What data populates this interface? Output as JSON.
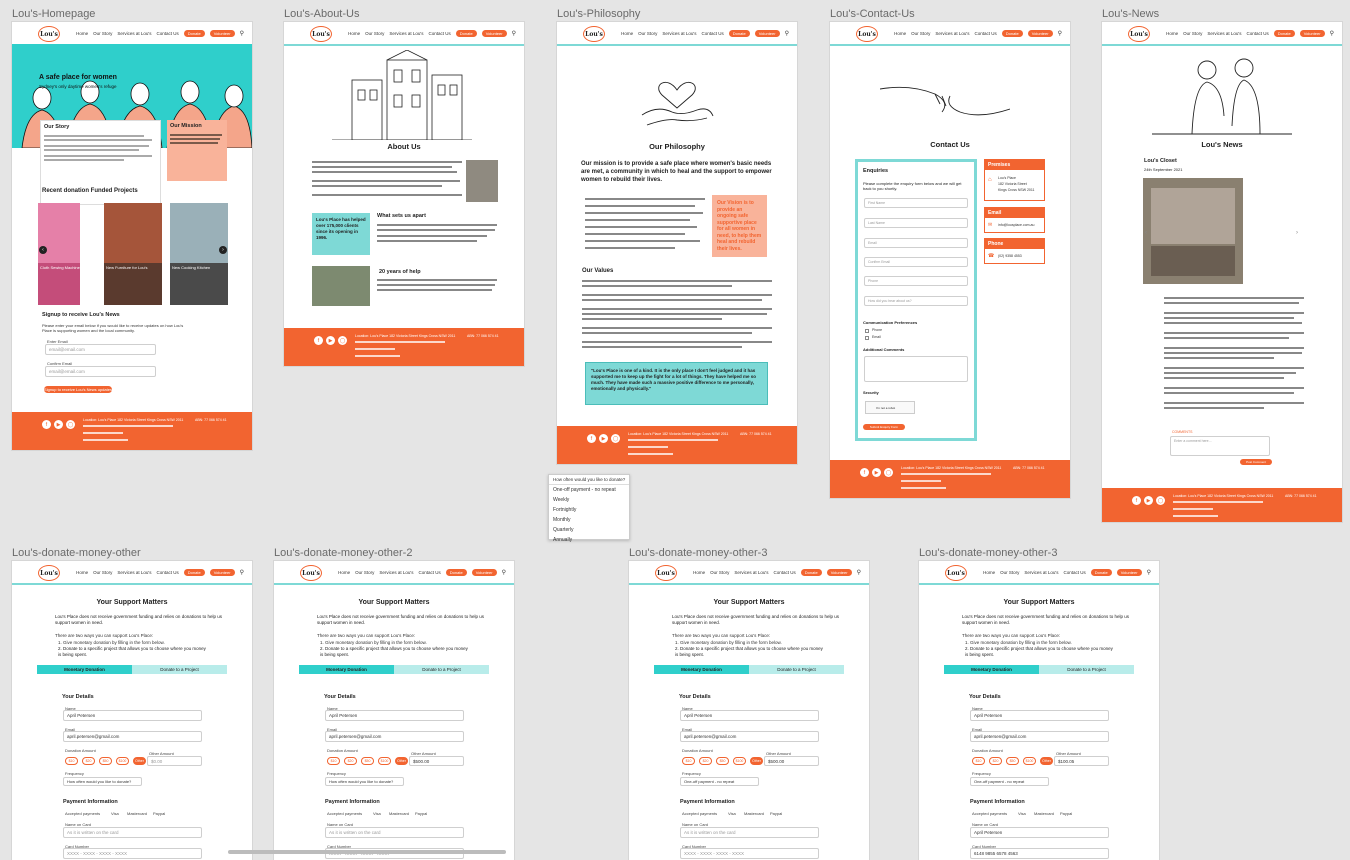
{
  "frames": {
    "homepage": {
      "label": "Lou's-Homepage"
    },
    "about": {
      "label": "Lou's-About-Us"
    },
    "philosophy": {
      "label": "Lou's-Philosophy"
    },
    "contact": {
      "label": "Lou's-Contact-Us"
    },
    "news": {
      "label": "Lou's-News"
    },
    "donate1": {
      "label": "Lou's-donate-money-other"
    },
    "donate2": {
      "label": "Lou's-donate-money-other-2"
    },
    "donate3": {
      "label": "Lou's-donate-money-other-3"
    },
    "donate4": {
      "label": "Lou's-donate-money-other-3"
    }
  },
  "nav": {
    "logo": "Lou's",
    "home": "Home",
    "our_story": "Our Story",
    "services": "Services at Lou's",
    "contact": "Contact Us",
    "donate": "Donate",
    "volunteer": "Volunteer"
  },
  "homepage": {
    "hero_title": "A safe place for women",
    "hero_subtitle": "Sydney's only daytime women's refuge",
    "our_story": "Our Story",
    "our_mission": "Our Mission",
    "recent_projects": "Recent donation Funded Projects",
    "project_1": "Cloth Sewing Machine",
    "project_2": "New Furniture for Lou's",
    "project_3": "New Cooking Kitchen",
    "signup_title": "Signup to receive Lou's News",
    "signup_text": "Please enter your email below if you would like to receive updates on how Lou's Place is supporting women and the local community.",
    "email_label": "Enter Email",
    "email_placeholder": "email@email.com",
    "confirm_label": "Confirm Email",
    "signup_button": "Signup to receive Lou's News updates"
  },
  "about": {
    "title": "About Us",
    "callout": "Lou's Place has helped over 175,000 clients since its opening in 1996.",
    "what_sets": "What sets us apart",
    "twenty_years": "20 years of help"
  },
  "philosophy": {
    "title": "Our Philosophy",
    "intro": "Our mission is to provide a safe place where women's basic needs are met, a community in which to heal and the support to empower women to rebuild their lives.",
    "vision": "Our Vision is to provide an ongoing safe supportive place for all women in need, to help them heal and rebuild their lives.",
    "values": "Our Values",
    "quote": "\"Lou's Place is one of a kind. It is the only place I don't feel judged and it has supported me to keep up the fight for a lot of things. They have helped me so much. They have made such a massive positive difference to me personally, emotionally and physically.\"",
    "dropdown_value": "How often would you like to donate?",
    "dropdown_options": [
      "One-off payment - no repeat",
      "Weekly",
      "Fortnightly",
      "Monthly",
      "Quarterly",
      "Annually"
    ]
  },
  "contact": {
    "title": "Contact Us",
    "enquiries": "Enquiries",
    "enquiries_text": "Please complete the enquiry form below and we will get back to you shortly.",
    "first_name": "First Name",
    "last_name": "Last Name",
    "email": "Email",
    "confirm_email": "Confirm Email",
    "phone": "Phone",
    "reason": "How did you hear about us?",
    "comm_pref": "Communication Preferences",
    "pref_phone": "Phone",
    "pref_email": "Email",
    "additional": "Additional Comments",
    "security": "Security",
    "not_robot": "I'm not a robot",
    "submit": "Submit Enquiry Form",
    "premises": "Premises",
    "address_1": "Lou's Place",
    "address_2": "182 Victoria Street",
    "address_3": "Kings Cross NSW 2011",
    "email_title": "Email",
    "email_value": "info@lousplace.com.au",
    "phone_title": "Phone",
    "phone_value": "(02) 9358 4553"
  },
  "news": {
    "title": "Lou's News",
    "article_title": "Lou's Closet",
    "article_date": "24th September 2021",
    "comments": "COMMENTS",
    "comment_placeholder": "Enter a comment here...",
    "post_button": "Post Comment"
  },
  "donate": {
    "title": "Your Support Matters",
    "intro": "Lou's Place does not receive government funding and relies on donations to help us support women in need.",
    "ways": "There are two ways you can support Lou's Place:",
    "way_1": "1. Give monetary donation by filling in the form below.",
    "way_2": "2. Donate to a specific project that allows you to choose where you money is being spent.",
    "tab_monetary": "Monetary Donation",
    "tab_project": "Donate to a Project",
    "your_details": "Your Details",
    "name_label": "Name",
    "name_value": "April Petersen",
    "email_label": "Email",
    "email_value": "april.petersen@gmail.com",
    "amount_label": "Donation Amount",
    "amounts": [
      "$10",
      "$20",
      "$50",
      "$100",
      "Other"
    ],
    "other_label": "Other Amount",
    "other_placeholder": "$0.00",
    "other_value": "$500.00",
    "other_value_4": "$100.05",
    "frequency_label": "Frequency",
    "frequency_placeholder": "How often would you like to donate?",
    "frequency_value": "One-off payment - no repeat",
    "payment_title": "Payment Information",
    "accepted": "Accepted payments",
    "visa": "Visa",
    "mastercard": "Mastercard",
    "paypal": "Paypal",
    "name_on_card": "Name on Card",
    "name_on_card_placeholder": "As it is written on the card",
    "card_number": "Card Number",
    "card_placeholder": "XXXX - XXXX - XXXX - XXXX",
    "card_value": "6148 9855 6578 4563"
  },
  "footer": {
    "location": "Location: Lou's Place 182 Victoria Street Kings Cross NSW 2011",
    "abn": "ABN: 77 066 574 41"
  }
}
